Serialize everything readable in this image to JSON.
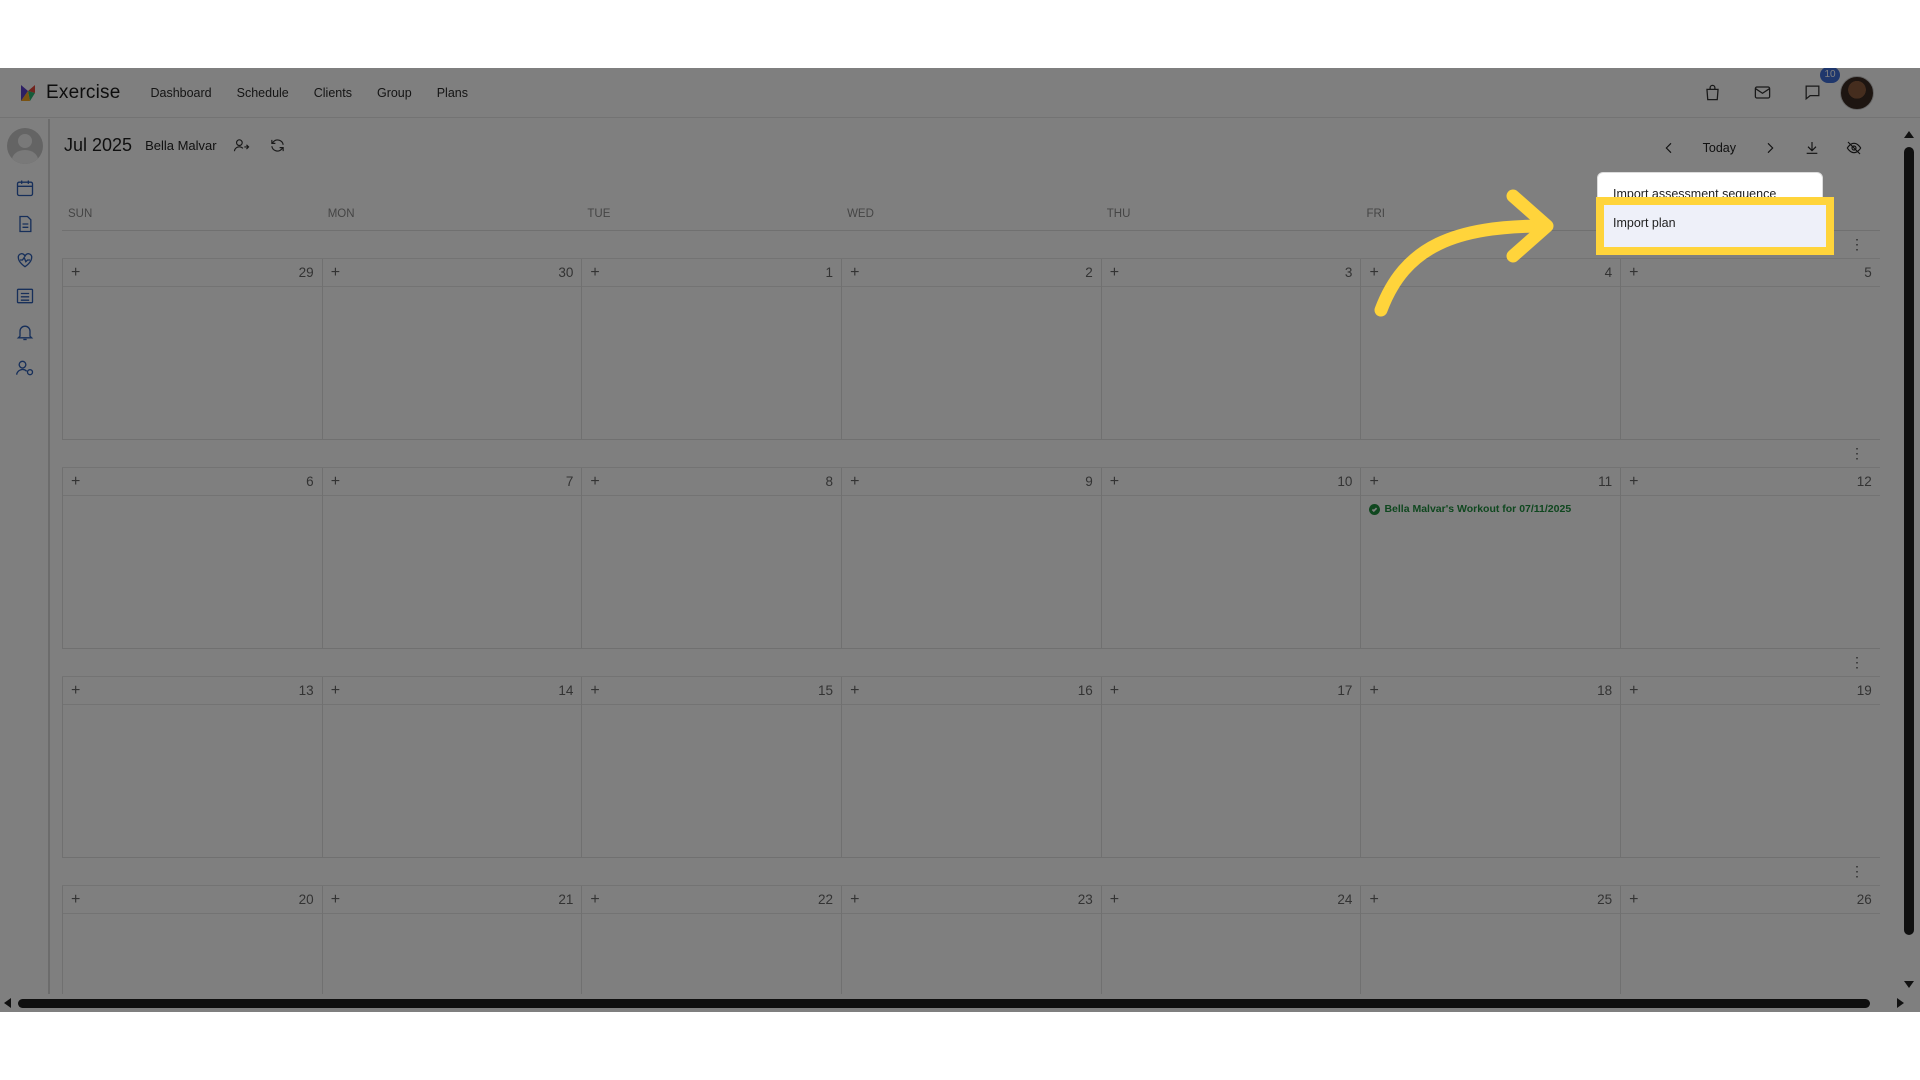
{
  "app": {
    "title": "Exercise",
    "nav": [
      "Dashboard",
      "Schedule",
      "Clients",
      "Group",
      "Plans"
    ],
    "icons": [
      "shopping-bag-icon",
      "mail-icon",
      "chat-icon"
    ],
    "chat_badge": "10"
  },
  "sidebar": {
    "icons": [
      "calendar-icon",
      "document-icon",
      "heart-pulse-icon",
      "list-icon",
      "bell-icon",
      "user-settings-icon"
    ]
  },
  "calendar": {
    "month": "Jul 2025",
    "client": "Bella Malvar",
    "today_label": "Today",
    "weekdays": [
      "SUN",
      "MON",
      "TUE",
      "WED",
      "THU",
      "FRI",
      "SAT"
    ],
    "weeks": [
      [
        "29",
        "30",
        "1",
        "2",
        "3",
        "4",
        "5"
      ],
      [
        "6",
        "7",
        "8",
        "9",
        "10",
        "11",
        "12"
      ],
      [
        "13",
        "14",
        "15",
        "16",
        "17",
        "18",
        "19"
      ],
      [
        "20",
        "21",
        "22",
        "23",
        "24",
        "25",
        "26"
      ]
    ],
    "event": {
      "label": "Bella Malvar's Workout for 07/11/2025",
      "color": "#1e8e3e"
    }
  },
  "menu": {
    "items": [
      "Import assessment sequence",
      "Import plan"
    ]
  },
  "colors": {
    "highlight": "#ffd43b",
    "accent": "#2e5fb5",
    "badge": "#3f6ed8"
  }
}
